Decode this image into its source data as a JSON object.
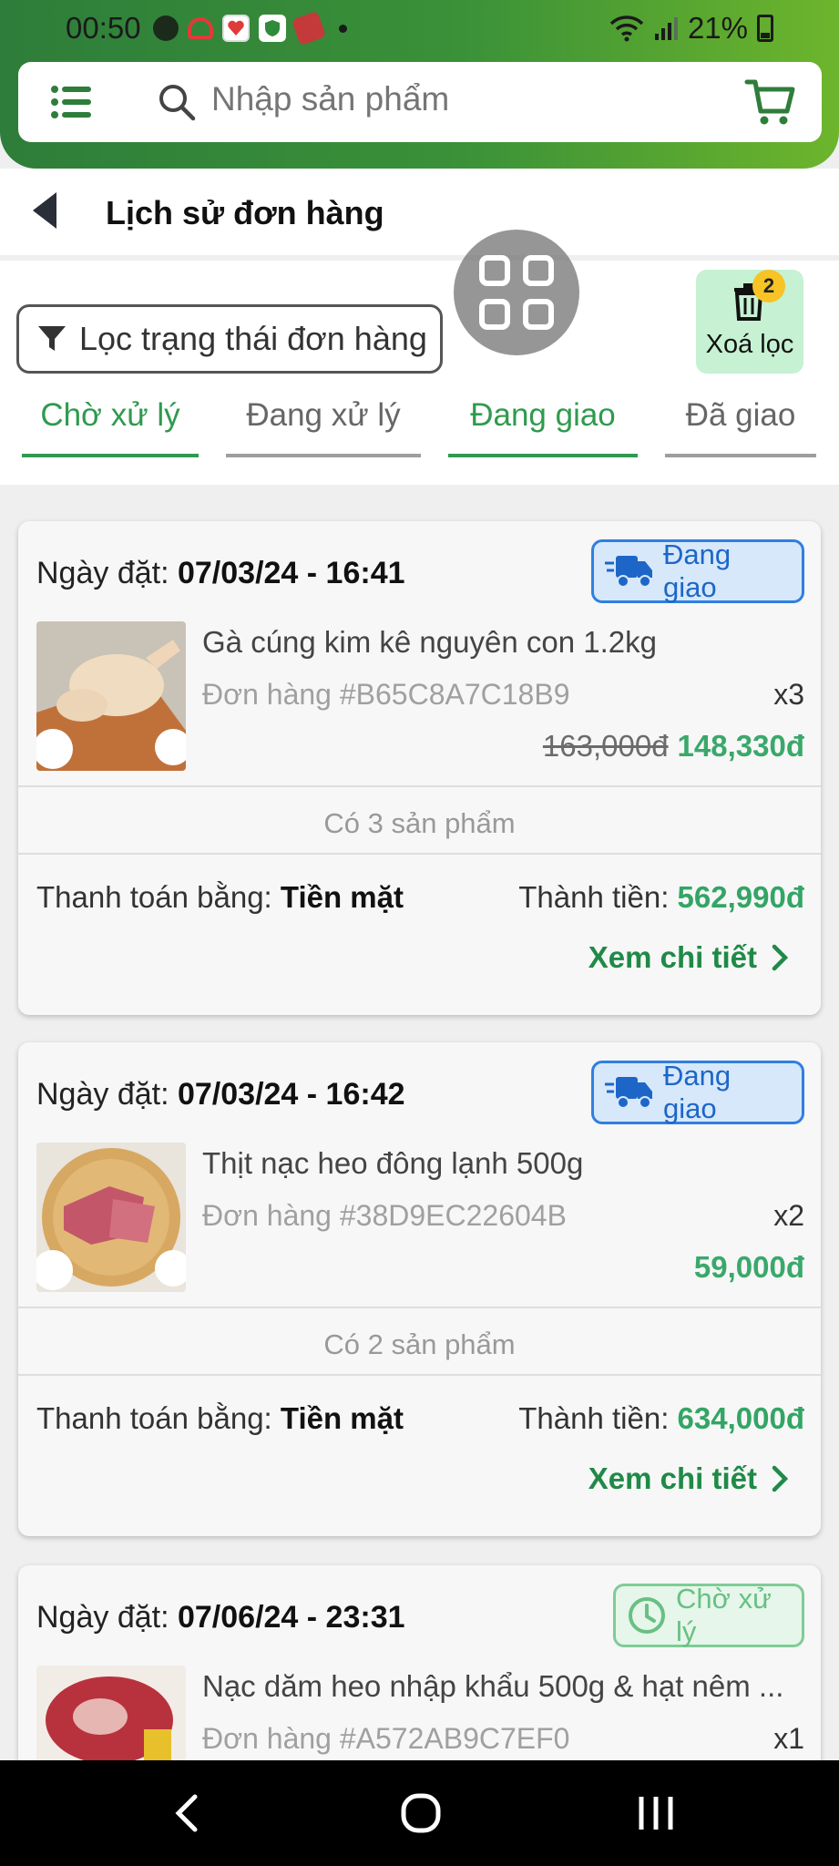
{
  "status_bar": {
    "time": "00:50",
    "battery": "21%",
    "app_icons": [
      "messenger-icon",
      "app-icon",
      "news-icon",
      "shield-icon",
      "sim-icon"
    ]
  },
  "search": {
    "placeholder": "Nhập sản phẩm"
  },
  "page": {
    "title": "Lịch sử đơn hàng"
  },
  "filter": {
    "label": "Lọc trạng thái đơn hàng",
    "clear_label": "Xoá lọc",
    "clear_badge": "2"
  },
  "tabs": [
    {
      "label": "Chờ xử lý",
      "active": true
    },
    {
      "label": "Đang xử lý",
      "active": false
    },
    {
      "label": "Đang giao",
      "active": true
    },
    {
      "label": "Đã giao",
      "active": false
    }
  ],
  "orders": [
    {
      "date_label": "Ngày đặt:",
      "date": "07/03/24 - 16:41",
      "status": "Đang giao",
      "product_name": "Gà cúng kim kê nguyên con 1.2kg",
      "order_code": "Đơn hàng #B65C8A7C18B9",
      "qty": "x3",
      "old_price": "163,000đ",
      "price": "148,330đ",
      "count": "Có 3 sản phẩm",
      "pay_label": "Thanh toán bằng:",
      "pay_method": "Tiền mặt",
      "total_label": "Thành tiền:",
      "total": "562,990đ",
      "detail": "Xem chi tiết"
    },
    {
      "date_label": "Ngày đặt:",
      "date": "07/03/24 - 16:42",
      "status": "Đang giao",
      "product_name": "Thịt nạc heo đông lạnh 500g",
      "order_code": "Đơn hàng #38D9EC22604B",
      "qty": "x2",
      "price": "59,000đ",
      "count": "Có 2 sản phẩm",
      "pay_label": "Thanh toán bằng:",
      "pay_method": "Tiền mặt",
      "total_label": "Thành tiền:",
      "total": "634,000đ",
      "detail": "Xem chi tiết"
    },
    {
      "date_label": "Ngày đặt:",
      "date": "07/06/24 - 23:31",
      "status": "Chờ xử lý",
      "product_name": "Nạc dăm heo nhập khẩu 500g & hạt nêm ...",
      "order_code": "Đơn hàng #A572AB9C7EF0",
      "qty": "x1"
    }
  ],
  "colors": {
    "brand_green": "#2f9a4e",
    "price_green": "#3aa86a",
    "shipping_blue": "#2f7fe0",
    "pending_green": "#7fcc96",
    "badge_yellow": "#f7c325"
  }
}
